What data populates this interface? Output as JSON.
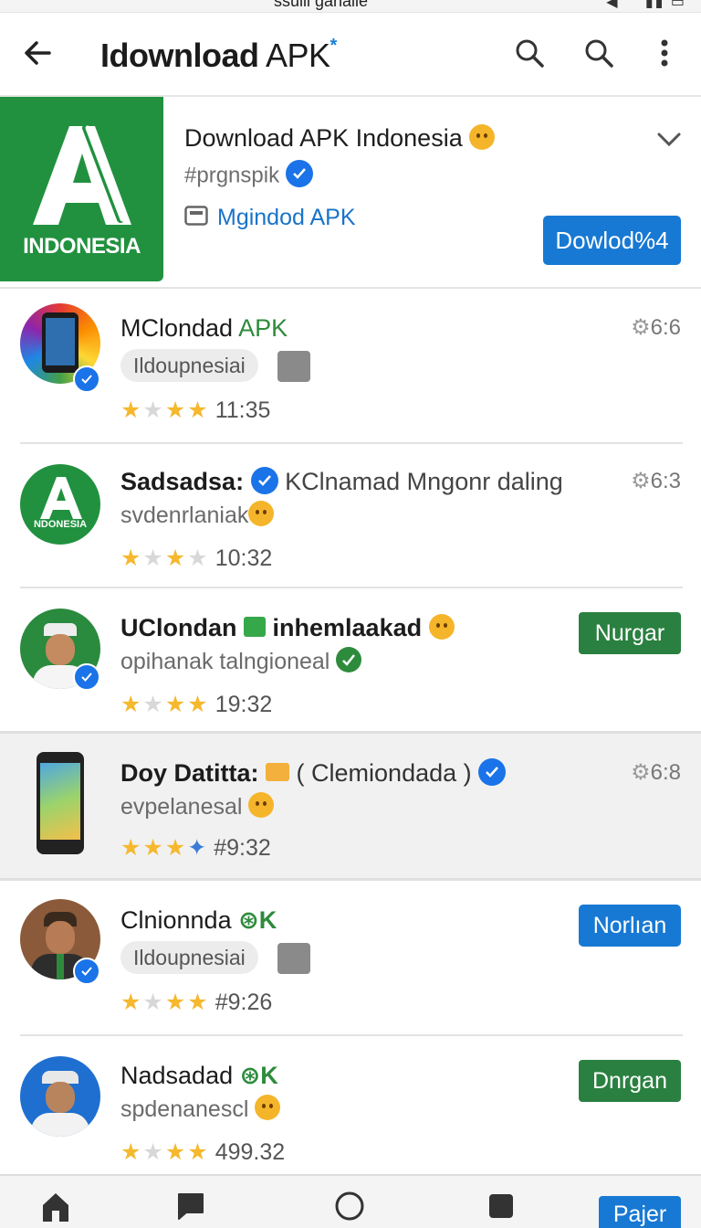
{
  "status_bar": {
    "carrier": "ssulli ganalie",
    "icons": "◀ ⌃ ▮▮ ▭"
  },
  "app_bar": {
    "title_bold": "Idownload",
    "title_rest": " APK",
    "title_mark": "*"
  },
  "featured": {
    "logo_text": "INDONESIA",
    "title": "Download APK Indonesia",
    "handle": "#prgnspik",
    "developer": "Mgindod APK",
    "button_label": "Dowlod%4"
  },
  "items": [
    {
      "title_a": "MClondad",
      "title_b": "APK",
      "chip": "Ildoupnesiai",
      "stars": 3,
      "time": "11:35",
      "meta": "6:6"
    },
    {
      "title_a": "Sadsadsa:",
      "title_b": "KClnamad Mngonr daling",
      "subtitle": "svdenrlaniak",
      "stars": 2,
      "time": "10:32",
      "meta": "6:3",
      "avatar_text": "NDONESIA"
    },
    {
      "title_a": "UClondan",
      "title_b": "inhemlaakad",
      "subtitle": "opihanak  talngioneal",
      "stars": 3,
      "time": "19:32",
      "button": "Nurgar"
    },
    {
      "title_a": "Doy Datitta:",
      "title_b": "( Clemiondada )",
      "subtitle": "evpelanesal",
      "stars": 3,
      "time": "#9:32",
      "meta": "6:8"
    },
    {
      "title_a": "Clnionnda",
      "title_b": "K",
      "chip": "Ildoupnesiai",
      "stars": 3,
      "time": "#9:26",
      "button": "Norlıan"
    },
    {
      "title_a": "Nadsadad",
      "title_b": "K",
      "subtitle": "spdenanescl",
      "stars": 3,
      "time": "499.32",
      "button": "Dnrgan"
    }
  ],
  "bottom_bar": {
    "button": "Pajer"
  },
  "colors": {
    "green": "#21913f",
    "blue": "#1779d3",
    "star": "#f5b82e"
  }
}
